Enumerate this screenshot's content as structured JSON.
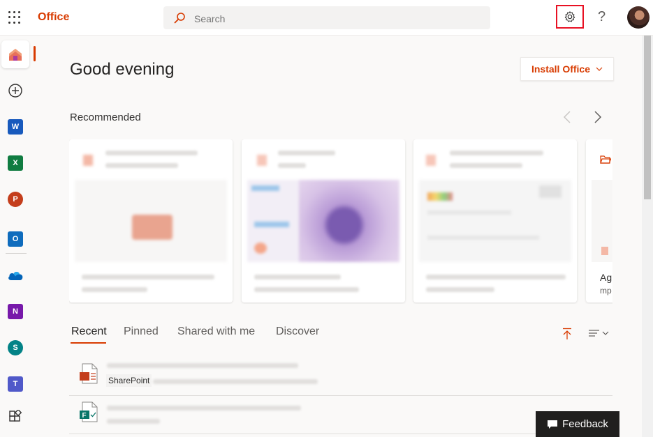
{
  "header": {
    "app_name": "Office",
    "search_placeholder": "Search",
    "help_label": "?"
  },
  "rail": {
    "items": [
      {
        "name": "Home"
      },
      {
        "name": "Create"
      },
      {
        "name": "Word",
        "letter": "W",
        "color": "#185abd"
      },
      {
        "name": "Excel",
        "letter": "X",
        "color": "#107c41"
      },
      {
        "name": "PowerPoint",
        "letter": "P",
        "color": "#c43e1c"
      },
      {
        "name": "Outlook",
        "letter": "O",
        "color": "#0f6cbd"
      },
      {
        "name": "OneDrive",
        "color": "#0364b8"
      },
      {
        "name": "OneNote",
        "letter": "N",
        "color": "#7719aa"
      },
      {
        "name": "SharePoint",
        "letter": "S",
        "color": "#038387"
      },
      {
        "name": "Teams",
        "letter": "T",
        "color": "#5059c9"
      },
      {
        "name": "All apps"
      }
    ]
  },
  "main": {
    "greeting": "Good evening",
    "install_label": "Install Office",
    "recommended_title": "Recommended",
    "partial_card": {
      "title": "Ag",
      "subtitle": "mp"
    },
    "tabs": [
      "Recent",
      "Pinned",
      "Shared with me",
      "Discover"
    ],
    "recent_rows": [
      {
        "source": "SharePoint",
        "type": "powerpoint"
      },
      {
        "source": "",
        "type": "forms"
      }
    ]
  },
  "feedback_label": "Feedback",
  "colors": {
    "accent": "#d83b01",
    "highlight_border": "#e81123"
  }
}
